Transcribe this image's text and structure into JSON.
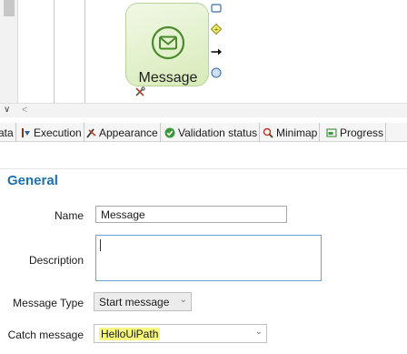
{
  "diagram": {
    "task_label": "Message",
    "palette_icons": [
      "task-shape-icon",
      "gateway-icon",
      "sequence-flow-arrow-icon",
      "event-circle-icon"
    ]
  },
  "tabs": [
    {
      "label": "ata",
      "icon": "data-icon"
    },
    {
      "label": "Execution",
      "icon": "execution-icon"
    },
    {
      "label": "Appearance",
      "icon": "appearance-icon"
    },
    {
      "label": "Validation status",
      "icon": "validation-check-icon"
    },
    {
      "label": "Minimap",
      "icon": "magnifier-icon"
    },
    {
      "label": "Progress",
      "icon": "progress-icon"
    }
  ],
  "properties": {
    "section_title": "General",
    "name_label": "Name",
    "name_value": "Message",
    "description_label": "Description",
    "description_value": "",
    "message_type_label": "Message Type",
    "message_type_value": "Start message",
    "catch_message_label": "Catch message",
    "catch_message_value": "HelloUiPath"
  },
  "colors": {
    "section_title": "#1f6fb0",
    "task_fill": "#d7ebb8",
    "highlight": "#f5f77e",
    "icon_green": "#4a8a2a"
  }
}
